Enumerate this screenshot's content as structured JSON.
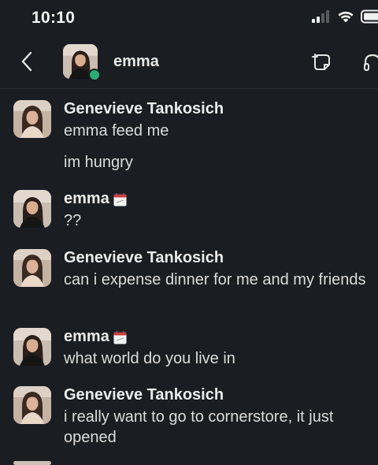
{
  "status_bar": {
    "time": "10:10"
  },
  "header": {
    "back_icon": "chevron-left-icon",
    "channel_name": "emma",
    "presence": "active",
    "actions": [
      "compose-icon",
      "headphones-icon"
    ]
  },
  "colors": {
    "background": "#1a1d21",
    "presence_green": "#2bac76",
    "text": "#dcdcdc"
  },
  "messages": [
    {
      "sender": "Genevieve Tankosich",
      "status_emoji": "",
      "lines": [
        "emma feed me",
        "im hungry"
      ]
    },
    {
      "sender": "emma",
      "status_emoji": "calendar-icon",
      "lines": [
        "??"
      ]
    },
    {
      "sender": "Genevieve Tankosich",
      "status_emoji": "",
      "lines": [
        "can i expense dinner for me and my friends"
      ]
    },
    {
      "sender": "emma",
      "status_emoji": "calendar-icon",
      "lines": [
        "what world do you live in"
      ]
    },
    {
      "sender": "Genevieve Tankosich",
      "status_emoji": "",
      "lines": [
        "i really want to go to cornerstore, it just opened"
      ]
    }
  ]
}
